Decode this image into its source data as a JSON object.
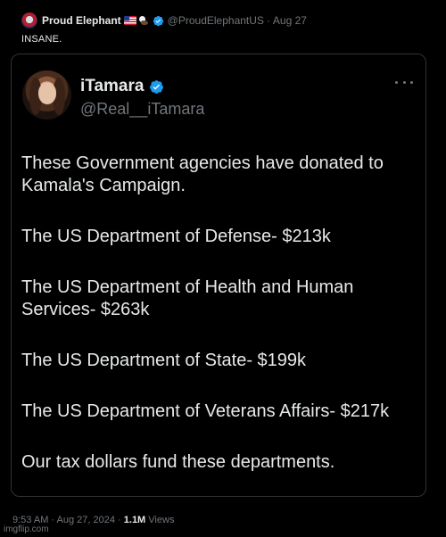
{
  "outer_tweet": {
    "author_name": "Proud Elephant",
    "author_handle": "@ProudElephantUS",
    "separator": "·",
    "date": "Aug 27",
    "text": "INSANE.",
    "badges": [
      "us-flag-icon",
      "eagle-icon",
      "verified-icon"
    ],
    "accent_color": "#1d9bf0"
  },
  "quoted_tweet": {
    "author_name": "iTamara",
    "author_handle": "@Real__iTamara",
    "paragraphs": [
      "These Government agencies have donated to Kamala's Campaign.",
      "The US Department of Defense- $213k",
      "The US Department of Health and Human Services- $263k",
      "The US Department of State- $199k",
      "The US Department of Veterans Affairs- $217k",
      "Our tax dollars fund these departments."
    ]
  },
  "meta": {
    "timestamp": "9:53 AM · Aug 27, 2024 ·",
    "views_count": "1.1M",
    "views_label": "Views"
  },
  "watermark": "imgflip.com",
  "colors": {
    "background": "#000000",
    "text_primary": "#e7e9ea",
    "text_secondary": "#71767b",
    "border": "#2f3336",
    "verified_blue": "#1d9bf0"
  }
}
